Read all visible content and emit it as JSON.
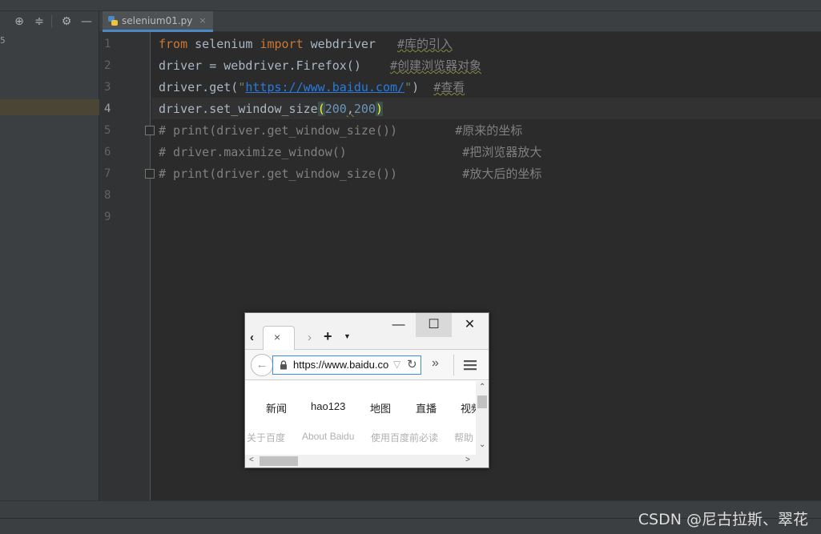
{
  "tab": {
    "label": "selenium01.py",
    "close": "×"
  },
  "toolbar": {
    "locate": "⊕",
    "collapse": "≑",
    "settings": "⚙",
    "hide": "—"
  },
  "project_panel": {
    "fragment": "5"
  },
  "gutter": [
    "1",
    "2",
    "3",
    "4",
    "5",
    "6",
    "7",
    "8",
    "9"
  ],
  "code": {
    "l1": {
      "kw1": "from",
      "t1": " selenium ",
      "kw2": "import",
      "t2": " webdriver   ",
      "comment": "#库的引入"
    },
    "l2": {
      "t1": "driver = webdriver.Firefox()    ",
      "comment": "#创建浏览器对象"
    },
    "l3": {
      "t1": "driver.get(",
      "q1": "\"",
      "url": "https://www.baidu.com/",
      "q2": "\"",
      "t2": ")  ",
      "comment": "#查看"
    },
    "l4": {
      "t1": "driver.set_window_size",
      "p1": "(",
      "n1": "200",
      "sep": ",",
      "n2": "200",
      "p2": ")"
    },
    "l5": "# print(driver.get_window_size())        #原来的坐标",
    "l6": "# driver.maximize_window()                #把浏览器放大",
    "l7": "# print(driver.get_window_size())         #放大后的坐标"
  },
  "browser": {
    "minimize": "—",
    "maximize": "☐",
    "close": "✕",
    "tab_close": "×",
    "scroll_tabs_left": "‹",
    "forward": "›",
    "new_tab": "+",
    "list_tabs": "▼",
    "back": "←",
    "url": "https://www.baidu.com/",
    "url_dropdown": "▽",
    "reload": "↻",
    "overflow": "»",
    "links": [
      "新闻",
      "hao123",
      "地图",
      "直播",
      "视频"
    ],
    "footer": [
      "关于百度",
      "About Baidu",
      "使用百度前必读",
      "帮助"
    ]
  },
  "watermark": "CSDN @尼古拉斯、翠花"
}
